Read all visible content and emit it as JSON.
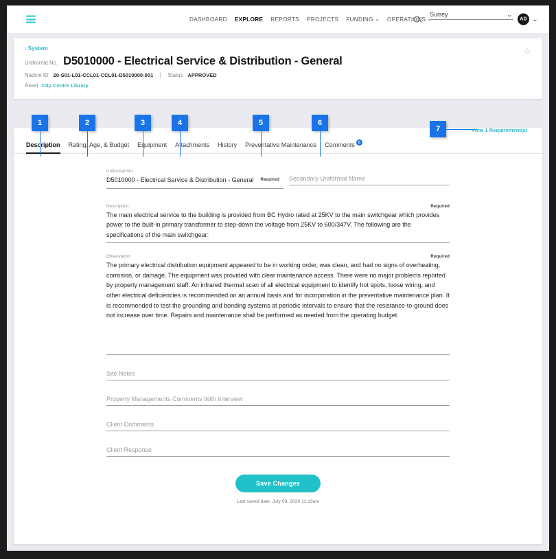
{
  "topnav": {
    "menu_icon": "hamburger-menu-icon",
    "links": [
      {
        "label": "DASHBOARD",
        "active": false,
        "caret": false
      },
      {
        "label": "EXPLORE",
        "active": true,
        "caret": false
      },
      {
        "label": "REPORTS",
        "active": false,
        "caret": false
      },
      {
        "label": "PROJECTS",
        "active": false,
        "caret": false
      },
      {
        "label": "FUNDING",
        "active": false,
        "caret": true
      },
      {
        "label": "OPERATIONS",
        "active": false,
        "caret": true
      }
    ],
    "search_icon": "search-icon",
    "site_select": {
      "value": "Surrey",
      "caret": "chevron-down-icon"
    },
    "avatar": {
      "initials": "AD",
      "caret": "chevron-down-icon"
    }
  },
  "header": {
    "breadcrumb": "System",
    "breadcrumb_arrow": "‹",
    "uniformat_no_label": "Uniformat No.",
    "title": "D5010000 - Electrical Service & Distribution - General",
    "nadine_id_label": "Nadine ID",
    "nadine_id_value": "20-S01-L01-CCL01-CCL01-D5010000-001",
    "status_label": "Status",
    "status_value": "APPROVED",
    "asset_label": "Asset",
    "asset_value": "City Centre Library",
    "favorite_icon": "star-outline-icon",
    "favorite_glyph": "☆"
  },
  "tabs": [
    {
      "label": "Description",
      "active": true,
      "badge": null
    },
    {
      "label": "Rating, Age, & Budget",
      "active": false,
      "badge": null
    },
    {
      "label": "Equipment",
      "active": false,
      "badge": null
    },
    {
      "label": "Attachments",
      "active": false,
      "badge": null
    },
    {
      "label": "History",
      "active": false,
      "badge": null
    },
    {
      "label": "Preventative Maintenance",
      "active": false,
      "badge": null
    },
    {
      "label": "Comments",
      "active": false,
      "badge": "0"
    }
  ],
  "requirements_link": "View 1 Requirement(s)",
  "form": {
    "uniformat_no": {
      "label": "Uniformat No.",
      "value": "D5010000 - Electrical Service & Distribution - General",
      "required_label": "Required"
    },
    "secondary_uniformat_name": {
      "placeholder": "Secondary Uniformat Name",
      "value": ""
    },
    "description": {
      "label": "Description",
      "required_label": "Required",
      "value": "The main electrical service to the building is provided from BC Hydro rated at 25KV to the main switchgear which provides power to the built-in primary transformer to step-down the voltage from 25KV to 600/347V. The following are the specifications of the main switchgear:"
    },
    "observation": {
      "label": "Observation",
      "required_label": "Required",
      "value": "The primary electrical distribution equipment appeared to be in working order, was clean, and had no signs of overheating, corrosion, or damage. The equipment was provided with clear maintenance access. There were no major problems reported by property management staff. An infrared thermal scan of all electrical equipment to identify hot spots, loose wiring, and other electrical deficiencies is recommended on an annual basis and for incorporation in the preventative maintenance plan. It is recommended to test the grounding and bonding systems at periodic intervals to ensure that the resistance-to-ground does not increase over time. Repairs and maintenance shall be performed as needed from the operating budget."
    },
    "site_notes": {
      "placeholder": "Site Notes",
      "value": ""
    },
    "property_management_comments": {
      "placeholder": "Property Managements Comments With Interview",
      "value": ""
    },
    "client_comments": {
      "placeholder": "Client Comments",
      "value": ""
    },
    "client_response": {
      "placeholder": "Client Response",
      "value": ""
    },
    "save_button": "Save Changes",
    "last_saved": "Last saved date: July 03, 2020 11:13am"
  },
  "annotations": [
    {
      "number": "1"
    },
    {
      "number": "2"
    },
    {
      "number": "3"
    },
    {
      "number": "4"
    },
    {
      "number": "5"
    },
    {
      "number": "6"
    },
    {
      "number": "7"
    }
  ],
  "colors": {
    "accent_teal": "#22c0c8",
    "annotation_blue": "#1a74e8",
    "badge_blue": "#1a74e8",
    "page_bg": "#e9ebf0",
    "card_bg": "#ffffff"
  }
}
